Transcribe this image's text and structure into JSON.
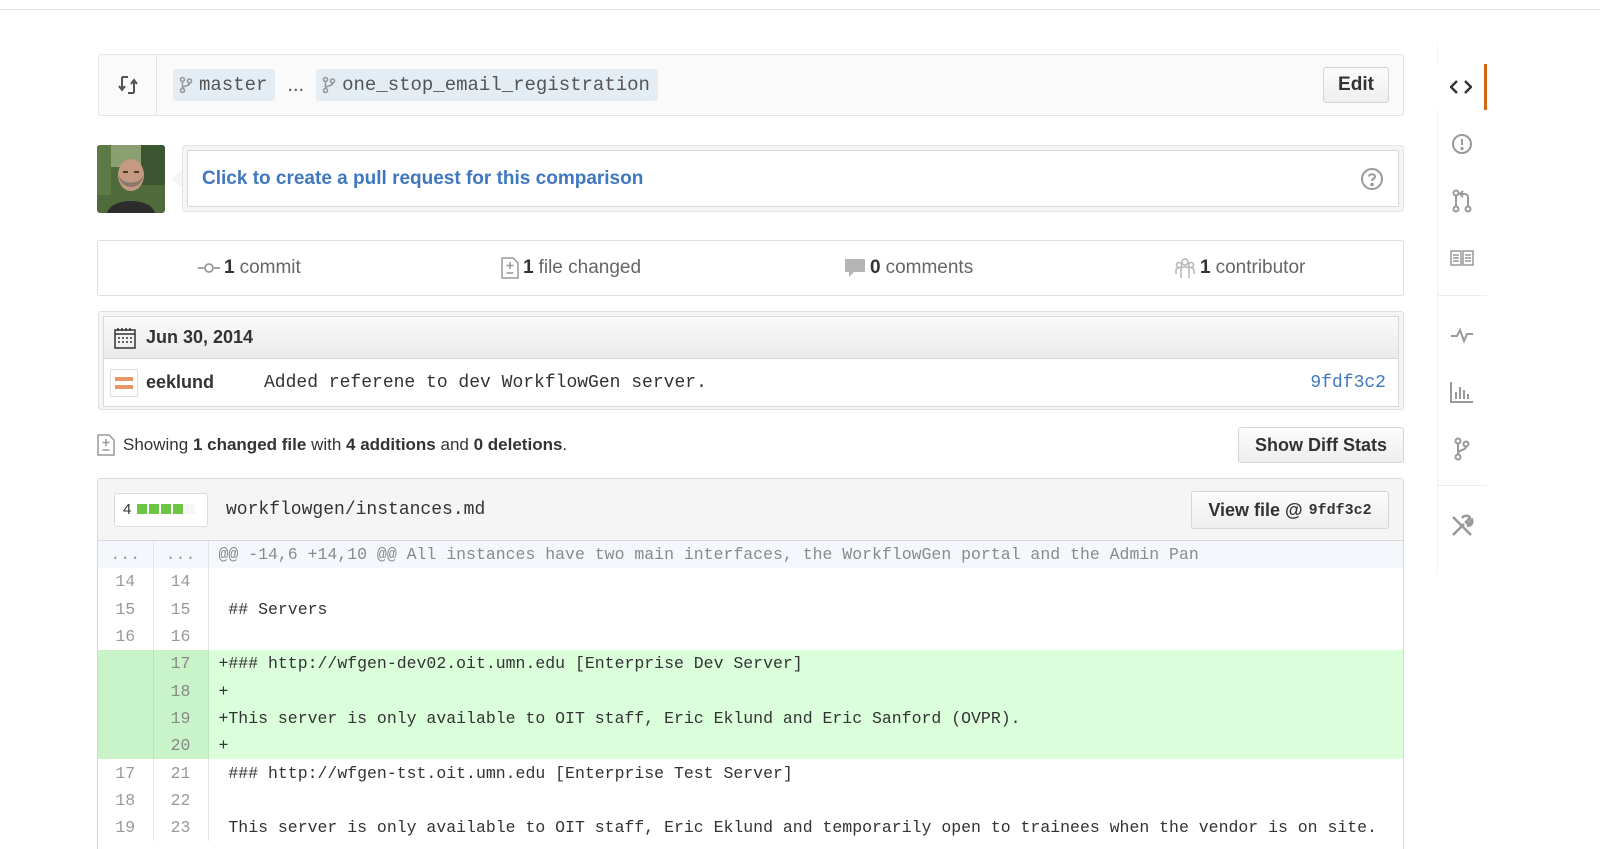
{
  "range": {
    "base_branch": "master",
    "separator": "...",
    "head_branch": "one_stop_email_registration",
    "edit_label": "Edit"
  },
  "pull_request": {
    "link_text": "Click to create a pull request for this comparison"
  },
  "summary": {
    "commits_count": "1",
    "commits_label": "commit",
    "files_count": "1",
    "files_label": "file changed",
    "comments_count": "0",
    "comments_label": "comments",
    "contributors_count": "1",
    "contributors_label": "contributor"
  },
  "commits": {
    "date": "Jun 30, 2014",
    "items": [
      {
        "author": "eeklund",
        "message": "Added referene to dev WorkflowGen server.",
        "sha": "9fdf3c2"
      }
    ]
  },
  "toc": {
    "prefix": "Showing",
    "changed": "1 changed file",
    "with": "with",
    "additions": "4 additions",
    "and": "and",
    "deletions": "0 deletions",
    "period": ".",
    "diff_stats_label": "Show Diff Stats"
  },
  "file": {
    "diffstat_count": "4",
    "diffstat_added_blocks": 4,
    "diffstat_total_blocks": 5,
    "path": "workflowgen/instances.md",
    "view_file_label": "View file @",
    "view_file_sha": "9fdf3c2",
    "lines": [
      {
        "type": "hunk",
        "old": "...",
        "new": "...",
        "text": "@@ -14,6 +14,10 @@ All instances have two main interfaces, the WorkflowGen portal and the Admin Pan"
      },
      {
        "type": "context",
        "old": "14",
        "new": "14",
        "text": ""
      },
      {
        "type": "context",
        "old": "15",
        "new": "15",
        "text": " ## Servers"
      },
      {
        "type": "context",
        "old": "16",
        "new": "16",
        "text": ""
      },
      {
        "type": "add",
        "old": "",
        "new": "17",
        "text": "+### http://wfgen-dev02.oit.umn.edu [Enterprise Dev Server]"
      },
      {
        "type": "add",
        "old": "",
        "new": "18",
        "text": "+"
      },
      {
        "type": "add",
        "old": "",
        "new": "19",
        "text": "+This server is only available to OIT staff, Eric Eklund and Eric Sanford (OVPR)."
      },
      {
        "type": "add",
        "old": "",
        "new": "20",
        "text": "+"
      },
      {
        "type": "context",
        "old": "17",
        "new": "21",
        "text": " ### http://wfgen-tst.oit.umn.edu [Enterprise Test Server]"
      },
      {
        "type": "context",
        "old": "18",
        "new": "22",
        "text": ""
      },
      {
        "type": "context",
        "old": "19",
        "new": "23",
        "text": " This server is only available to OIT staff, Eric Eklund and temporarily open to trainees when the vendor is on site."
      }
    ]
  },
  "sidebar": {
    "items": [
      {
        "icon": "code-icon",
        "selected": true
      },
      {
        "icon": "issues-icon"
      },
      {
        "icon": "pull-requests-icon"
      },
      {
        "icon": "wiki-icon"
      },
      {
        "icon": "pulse-icon"
      },
      {
        "icon": "graphs-icon"
      },
      {
        "icon": "network-icon"
      },
      {
        "icon": "settings-icon"
      }
    ],
    "accent_color": "#d26911"
  },
  "colors": {
    "link": "#4078c0",
    "addition_bg": "#dbffdb",
    "addition_gutter": "#c9f4c9",
    "hunk_bg": "#f4f7fb",
    "diffstat_add": "#6cc644"
  }
}
